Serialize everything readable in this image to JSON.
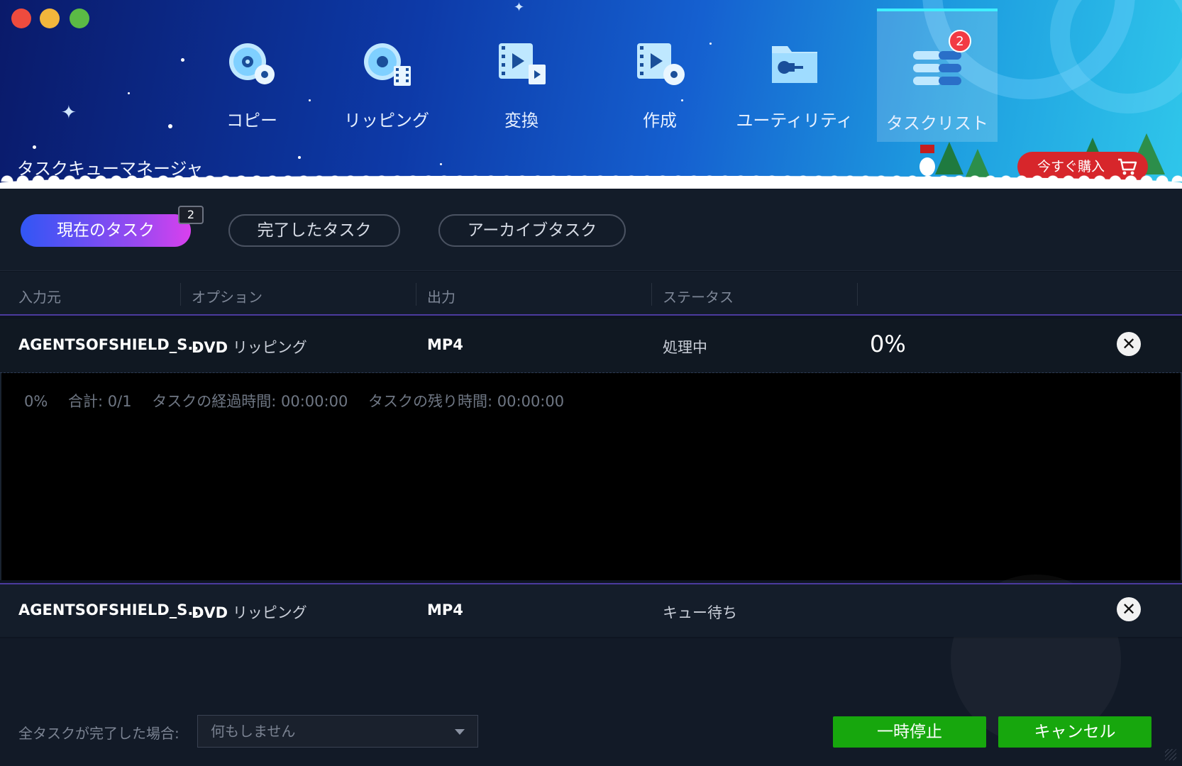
{
  "window": {
    "traffic_lights": {
      "close_color": "#ee4b3e",
      "minimize_color": "#f2b63c",
      "zoom_color": "#5bbb45"
    }
  },
  "header": {
    "app_title": "タスクキューマネージャ",
    "nav": [
      {
        "label": "コピー",
        "icon": "disc-copy-icon"
      },
      {
        "label": "リッピング",
        "icon": "disc-ripping-icon"
      },
      {
        "label": "変換",
        "icon": "video-convert-icon"
      },
      {
        "label": "作成",
        "icon": "disc-create-icon"
      },
      {
        "label": "ユーティリティ",
        "icon": "utility-folder-icon"
      },
      {
        "label": "タスクリスト",
        "icon": "task-list-icon",
        "active": true,
        "badge": "2"
      }
    ],
    "buy_button": "今すぐ購入"
  },
  "filters": {
    "tabs": [
      {
        "label": "現在のタスク",
        "active": true,
        "count": "2"
      },
      {
        "label": "完了したタスク"
      },
      {
        "label": "アーカイブタスク"
      }
    ]
  },
  "table": {
    "columns": [
      "入力元",
      "オプション",
      "出力",
      "ステータス"
    ],
    "rows": [
      {
        "source": "AGENTSOFSHIELD_S...",
        "option_prefix": "DVD",
        "option": "リッピング",
        "output": "MP4",
        "status": "処理中",
        "progress": "0%"
      },
      {
        "source": "AGENTSOFSHIELD_S...",
        "option_prefix": "DVD",
        "option": "リッピング",
        "output": "MP4",
        "status": "キュー待ち"
      }
    ],
    "summary": {
      "percent": "0%",
      "total": "合計: 0/1",
      "elapsed": "タスクの経過時間: 00:00:00",
      "remaining": "タスクの残り時間: 00:00:00"
    }
  },
  "footer": {
    "on_complete_label": "全タスクが完了した場合:",
    "on_complete_value": "何もしません",
    "pause_button": "一時停止",
    "cancel_button": "キャンセル"
  },
  "colors": {
    "accent_green": "#17a70d",
    "buy_red": "#d7262b",
    "badge_red": "#f23b44",
    "active_tab_gradient_start": "#3156f5",
    "active_tab_gradient_end": "#d940ee"
  }
}
